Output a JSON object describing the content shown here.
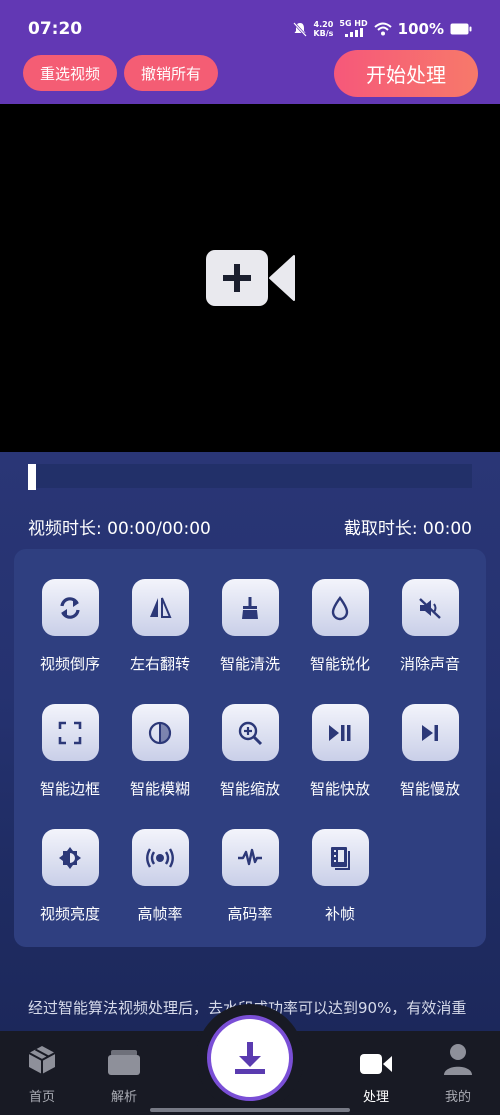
{
  "status_bar": {
    "time": "07:20",
    "speed_value": "4.20",
    "speed_unit": "KB/s",
    "network": "5G HD",
    "battery": "100%"
  },
  "toolbar": {
    "reselect_label": "重选视频",
    "undo_all_label": "撤销所有",
    "start_label": "开始处理"
  },
  "player": {
    "progress": 0,
    "duration_label": "视频时长: 00:00/00:00",
    "clip_label": "截取时长: 00:00"
  },
  "tools": [
    {
      "label": "视频倒序",
      "icon": "reverse-icon"
    },
    {
      "label": "左右翻转",
      "icon": "flip-icon"
    },
    {
      "label": "智能清洗",
      "icon": "broom-icon"
    },
    {
      "label": "智能锐化",
      "icon": "drop-icon"
    },
    {
      "label": "消除声音",
      "icon": "mute-icon"
    },
    {
      "label": "智能边框",
      "icon": "frame-icon"
    },
    {
      "label": "智能模糊",
      "icon": "blur-icon"
    },
    {
      "label": "智能缩放",
      "icon": "zoom-icon"
    },
    {
      "label": "智能快放",
      "icon": "play-pause-icon"
    },
    {
      "label": "智能慢放",
      "icon": "skip-next-icon"
    },
    {
      "label": "视频亮度",
      "icon": "brightness-icon"
    },
    {
      "label": "高帧率",
      "icon": "broadcast-icon"
    },
    {
      "label": "高码率",
      "icon": "waveform-icon"
    },
    {
      "label": "补帧",
      "icon": "film-icon"
    }
  ],
  "description": "经过智能算法视频处理后，去水印成功率可以达到90%，有效消重",
  "nav": {
    "home": "首页",
    "parse": "解析",
    "process": "处理",
    "mine": "我的"
  },
  "colors": {
    "brand_purple": "#6238b4",
    "accent_pink": "#f45d74",
    "icon_navy": "#2c3878"
  }
}
